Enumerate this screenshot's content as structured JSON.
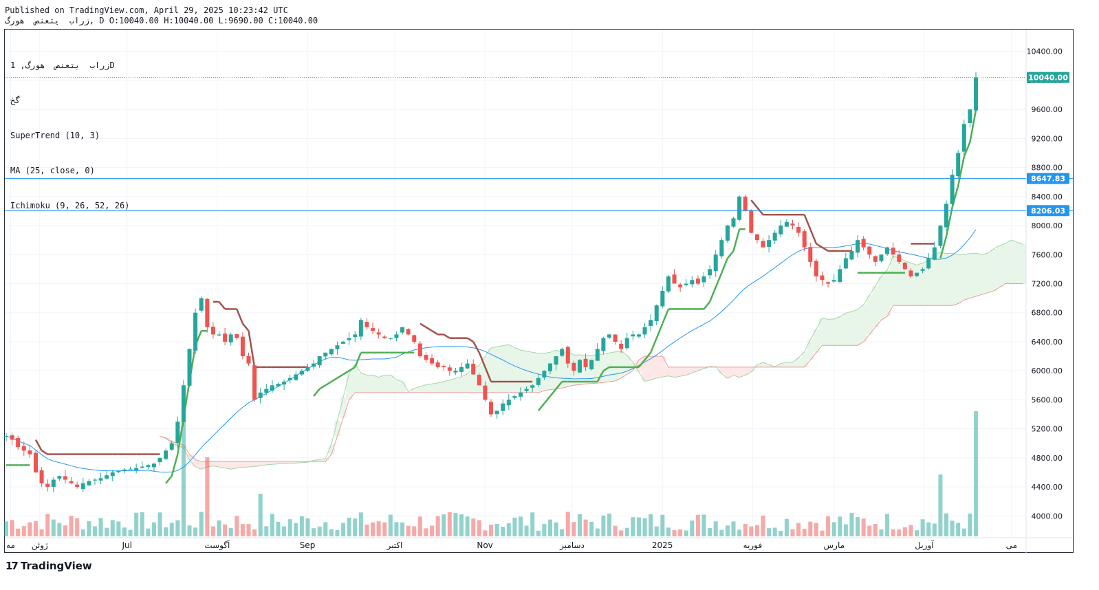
{
  "header": {
    "published": "Published on TradingView.com, April 29, 2025 10:23:42 UTC",
    "ohlc_line": "زراب  یتعنص  هورگ, D O:10040.00 H:10040.00 L:9690.00 C:10040.00"
  },
  "legend": {
    "symbol_line": "زراب  یتعنص  هورگ, 1D",
    "exchange_line": "گخ",
    "indicator_supertrend": "SuperTrend (10, 3)",
    "indicator_ma": "MA (25, close, 0)",
    "indicator_ichimoku": "Ichimoku (9, 26, 52, 26)"
  },
  "price_labels": {
    "last": "10040.00",
    "line1": "8647.83",
    "line2": "8206.03"
  },
  "footer": {
    "logo_text": "TradingView"
  },
  "colors": {
    "up": "#26a69a",
    "down": "#ef5350",
    "supertrend_up": "#4caf50",
    "supertrend_down": "#a0524c",
    "ma": "#2196f3",
    "cloud_bull": "#e8f5e9",
    "cloud_bear": "#fde7e7",
    "hline": "#2196f3"
  },
  "chart_data": {
    "type": "candlestick",
    "ylim": [
      3700,
      10700
    ],
    "y_ticks": [
      4000,
      4400,
      4800,
      5200,
      5600,
      6000,
      6400,
      6800,
      7200,
      7600,
      8000,
      8400,
      8800,
      9200,
      9600,
      10000,
      10400
    ],
    "x_labels": [
      {
        "label": "مه",
        "date": "2024-05-22"
      },
      {
        "label": "ژوئن",
        "date": "2024-06-01"
      },
      {
        "label": "Jul",
        "date": "2024-07-01"
      },
      {
        "label": "آگوست",
        "date": "2024-08-01"
      },
      {
        "label": "Sep",
        "date": "2024-09-01"
      },
      {
        "label": "اکتبر",
        "date": "2024-10-01"
      },
      {
        "label": "Nov",
        "date": "2024-11-01"
      },
      {
        "label": "دسامبر",
        "date": "2024-12-01"
      },
      {
        "label": "2025",
        "date": "2025-01-01"
      },
      {
        "label": "فوریه",
        "date": "2025-02-01"
      },
      {
        "label": "مارس",
        "date": "2025-03-01"
      },
      {
        "label": "آوریل",
        "date": "2025-04-01"
      },
      {
        "label": "می",
        "date": "2025-05-01"
      }
    ],
    "horizontal_lines": [
      8647.83,
      8206.03
    ],
    "last_price": 10040.0,
    "candles_close_approx": [
      5100,
      5050,
      4950,
      4900,
      4850,
      4600,
      4450,
      4400,
      4500,
      4550,
      4500,
      4450,
      4400,
      4450,
      4480,
      4500,
      4520,
      4560,
      4600,
      4620,
      4640,
      4650,
      4660,
      4680,
      4700,
      4720,
      4800,
      4900,
      5000,
      5300,
      5800,
      6300,
      6800,
      7000,
      6600,
      6500,
      6500,
      6400,
      6500,
      6450,
      6200,
      6100,
      5600,
      5700,
      5750,
      5800,
      5820,
      5850,
      5900,
      5950,
      6000,
      6050,
      6100,
      6200,
      6250,
      6300,
      6350,
      6400,
      6450,
      6500,
      6700,
      6600,
      6550,
      6500,
      6450,
      6450,
      6500,
      6600,
      6500,
      6400,
      6200,
      6150,
      6100,
      6050,
      6050,
      6000,
      6000,
      6050,
      6100,
      5950,
      5800,
      5600,
      5400,
      5450,
      5550,
      5600,
      5650,
      5700,
      5750,
      5800,
      5900,
      6000,
      6100,
      6200,
      6300,
      6100,
      6000,
      6150,
      6050,
      6150,
      6300,
      6450,
      6500,
      6400,
      6300,
      6450,
      6500,
      6500,
      6600,
      6700,
      6900,
      7100,
      7300,
      7200,
      7150,
      7200,
      7250,
      7200,
      7300,
      7400,
      7600,
      7800,
      8000,
      8100,
      8400,
      8200,
      7900,
      7800,
      7700,
      7800,
      7900,
      8000,
      8050,
      8000,
      7900,
      7700,
      7500,
      7300,
      7250,
      7200,
      7250,
      7400,
      7550,
      7650,
      7800,
      7700,
      7600,
      7500,
      7600,
      7700,
      7600,
      7500,
      7400,
      7300,
      7350,
      7400,
      7550,
      7700,
      8000,
      8300,
      8700,
      9000,
      9400,
      9600,
      10040
    ],
    "volume_relative": "volume bars at bottom; peak volume at last bar",
    "series": [
      {
        "name": "SuperTrend (10, 3)"
      },
      {
        "name": "MA (25, close, 0)"
      },
      {
        "name": "Ichimoku (9, 26, 52, 26)"
      }
    ]
  }
}
